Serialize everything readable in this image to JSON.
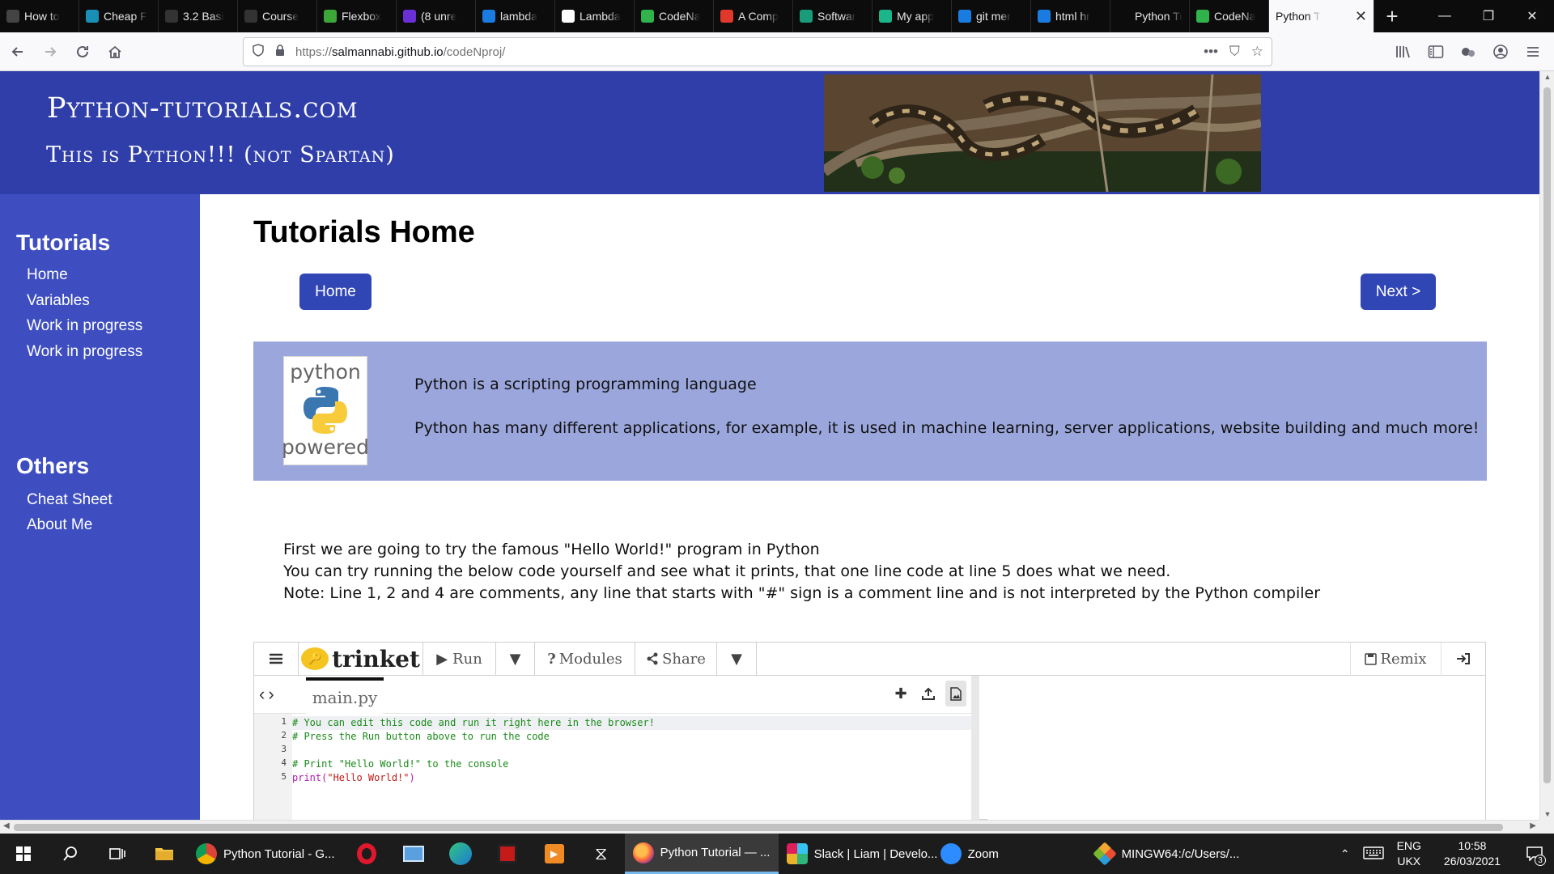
{
  "browser": {
    "tabs": [
      {
        "label": "How to",
        "icon": "question-icon",
        "color": "#444444"
      },
      {
        "label": "Cheap F",
        "icon": "list-icon",
        "color": "#1a8fb5"
      },
      {
        "label": "3.2 Basi",
        "icon": "edx-icon",
        "color": "#333333"
      },
      {
        "label": "Course",
        "icon": "edx-icon",
        "color": "#333333"
      },
      {
        "label": "Flexbox",
        "icon": "puzzle-icon",
        "color": "#3da638"
      },
      {
        "label": "(8 unre",
        "icon": "mail-icon",
        "color": "#6b2fd6"
      },
      {
        "label": "lambda",
        "icon": "bing-icon",
        "color": "#1a7ce0"
      },
      {
        "label": "Lambda",
        "icon": "dg-icon",
        "color": "#ffffff"
      },
      {
        "label": "CodeNa",
        "icon": "board-icon",
        "color": "#2fb34a"
      },
      {
        "label": "A Comp",
        "icon": "star-icon",
        "color": "#e0392b"
      },
      {
        "label": "Softwar",
        "icon": "wave-icon",
        "color": "#1a9c7a"
      },
      {
        "label": "My app",
        "icon": "qa-icon",
        "color": "#1bb58a"
      },
      {
        "label": "git mer",
        "icon": "bing-icon",
        "color": "#1a7ce0"
      },
      {
        "label": "html hr",
        "icon": "bing-icon",
        "color": "#1a7ce0"
      },
      {
        "label": "Python Tuto",
        "icon": "none",
        "color": "#0c0c0d"
      },
      {
        "label": "CodeNa",
        "icon": "board-icon",
        "color": "#2fb34a"
      }
    ],
    "active_tab": {
      "label": "Python T",
      "close": "✕"
    },
    "new_tab": "+",
    "window_controls": {
      "minimize": "—",
      "maximize": "❐",
      "close": "✕"
    },
    "url_prefix": "https://",
    "url_host": "salmannabi.github.io",
    "url_path": "/codeNproj/",
    "url_actions": {
      "more": "•••",
      "pocket": "⛉",
      "bookmark": "☆"
    }
  },
  "site": {
    "title": "Python-tutorials.com",
    "subtitle": "This is Python!!! (not Spartan)"
  },
  "sidebar": {
    "section1": "Tutorials",
    "links1": [
      "Home",
      "Variables",
      "Work in progress",
      "Work in progress"
    ],
    "section2": "Others",
    "links2": [
      "Cheat Sheet",
      "About Me"
    ]
  },
  "main": {
    "title": "Tutorials Home",
    "home_button": "Home",
    "next_button": "Next >",
    "logo_top": "python",
    "logo_bottom": "powered",
    "intro1": "Python is a scripting programming language",
    "intro2": "Python has many different applications, for example, it is used in machine learning, server applications, website building and much more!",
    "para1": "First we are going to try the famous \"Hello World!\" program in Python",
    "para2": "You can try running the below code yourself and see what it prints, that one line code at line 5 does what we need.",
    "para3": "Note: Line 1, 2 and 4 are comments, any line that starts with \"#\" sign is a comment line and is not interpreted by the Python compiler"
  },
  "trinket": {
    "brand": "trinket",
    "run": "Run",
    "modules": "Modules",
    "share": "Share",
    "remix": "Remix",
    "file_tab": "main.py",
    "lines": [
      {
        "n": "1",
        "code": "# You can edit this code and run it right here in the browser!",
        "kind": "comment"
      },
      {
        "n": "2",
        "code": "# Press the Run button above to run the code",
        "kind": "comment"
      },
      {
        "n": "3",
        "code": "",
        "kind": "blank"
      },
      {
        "n": "4",
        "code": "# Print \"Hello World!\" to the console",
        "kind": "comment"
      },
      {
        "n": "5",
        "code_fn": "print(",
        "code_str": "\"Hello World!\"",
        "code_end": ")",
        "kind": "call"
      }
    ],
    "colors": {
      "comment": "#1a8a1a",
      "keyword": "#b01cb0",
      "string": "#c41a16"
    }
  },
  "taskbar": {
    "apps": [
      {
        "label": "Python Tutorial - G...",
        "icon": "chrome-icon",
        "active": false
      },
      {
        "label": "Python Tutorial — ...",
        "icon": "firefox-icon",
        "active": true
      },
      {
        "label": "Slack | Liam | Develo...",
        "icon": "slack-icon",
        "active": false
      },
      {
        "label": "Zoom",
        "icon": "zoom-icon",
        "active": false
      },
      {
        "label": "MINGW64:/c/Users/...",
        "icon": "git-icon",
        "active": false
      }
    ],
    "lang_top": "ENG",
    "lang_bottom": "UKX",
    "time": "10:58",
    "date": "26/03/2021",
    "notifications": "3"
  },
  "colors": {
    "header_blue": "#2f3ea8",
    "sidebar_blue": "#3e4ec0",
    "button_blue": "#3146b5",
    "intro_box": "#9ba7dc"
  }
}
